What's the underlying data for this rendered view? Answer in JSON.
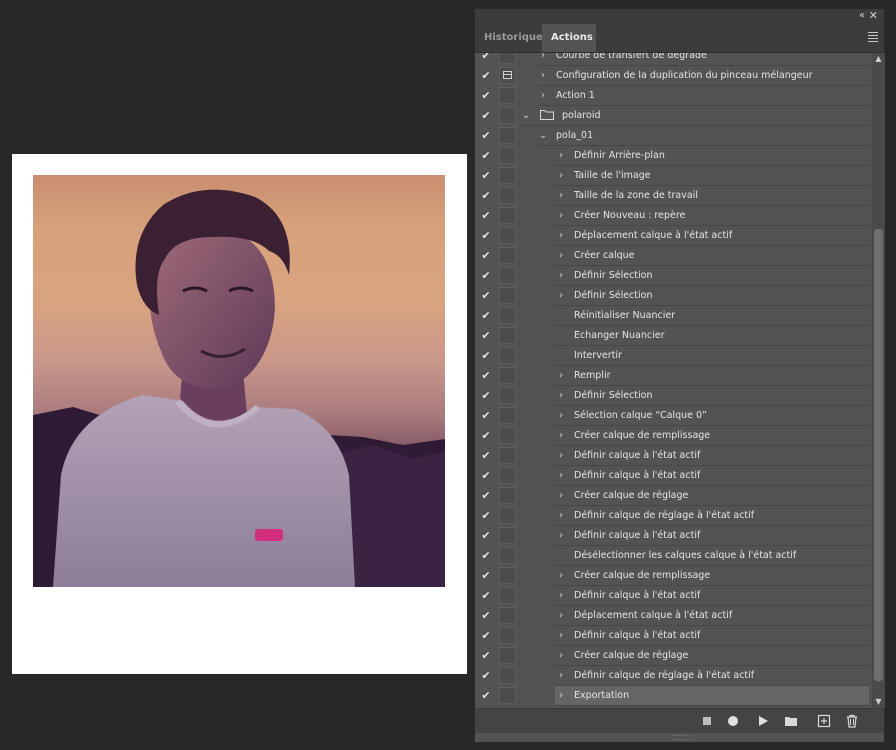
{
  "tabs": {
    "historique": "Historique",
    "actions": "Actions"
  },
  "panel_controls": {
    "collapse_glyph": "‹‹",
    "close_glyph": "✕"
  },
  "checkmark": "✔",
  "rows": [
    {
      "label": "Courbe de transfert de dégradé",
      "level": 1,
      "twisty": "›",
      "checked": true,
      "dialog": false,
      "folder": false
    },
    {
      "label": "Configuration de la duplication du pinceau mélangeur",
      "level": 1,
      "twisty": "›",
      "checked": true,
      "dialog": true,
      "folder": false
    },
    {
      "label": "Action 1",
      "level": 1,
      "twisty": "›",
      "checked": true,
      "dialog": false,
      "folder": false
    },
    {
      "label": "polaroid",
      "level": 0,
      "twisty": "⌄",
      "checked": true,
      "dialog": false,
      "folder": true
    },
    {
      "label": "pola_01",
      "level": 1,
      "twisty": "⌄",
      "checked": true,
      "dialog": false,
      "folder": false
    },
    {
      "label": "Définir Arrière-plan",
      "level": 2,
      "twisty": "›",
      "checked": true,
      "dialog": false,
      "folder": false
    },
    {
      "label": "Taille de l'image",
      "level": 2,
      "twisty": "›",
      "checked": true,
      "dialog": false,
      "folder": false
    },
    {
      "label": "Taille de la zone de travail",
      "level": 2,
      "twisty": "›",
      "checked": true,
      "dialog": false,
      "folder": false
    },
    {
      "label": "Créer Nouveau : repère",
      "level": 2,
      "twisty": "›",
      "checked": true,
      "dialog": false,
      "folder": false
    },
    {
      "label": "Déplacement calque à l'état actif",
      "level": 2,
      "twisty": "›",
      "checked": true,
      "dialog": false,
      "folder": false
    },
    {
      "label": "Créer calque",
      "level": 2,
      "twisty": "›",
      "checked": true,
      "dialog": false,
      "folder": false
    },
    {
      "label": "Définir Sélection",
      "level": 2,
      "twisty": "›",
      "checked": true,
      "dialog": false,
      "folder": false
    },
    {
      "label": "Définir Sélection",
      "level": 2,
      "twisty": "›",
      "checked": true,
      "dialog": false,
      "folder": false
    },
    {
      "label": "Réinitialiser Nuancier",
      "level": 2,
      "twisty": "",
      "checked": true,
      "dialog": false,
      "folder": false
    },
    {
      "label": "Echanger Nuancier",
      "level": 2,
      "twisty": "",
      "checked": true,
      "dialog": false,
      "folder": false
    },
    {
      "label": "Intervertir",
      "level": 2,
      "twisty": "",
      "checked": true,
      "dialog": false,
      "folder": false
    },
    {
      "label": "Remplir",
      "level": 2,
      "twisty": "›",
      "checked": true,
      "dialog": false,
      "folder": false
    },
    {
      "label": "Définir Sélection",
      "level": 2,
      "twisty": "›",
      "checked": true,
      "dialog": false,
      "folder": false
    },
    {
      "label": "Sélection calque “Calque 0”",
      "level": 2,
      "twisty": "›",
      "checked": true,
      "dialog": false,
      "folder": false
    },
    {
      "label": "Créer calque de remplissage",
      "level": 2,
      "twisty": "›",
      "checked": true,
      "dialog": false,
      "folder": false
    },
    {
      "label": "Définir calque à l'état actif",
      "level": 2,
      "twisty": "›",
      "checked": true,
      "dialog": false,
      "folder": false
    },
    {
      "label": "Définir calque à l'état actif",
      "level": 2,
      "twisty": "›",
      "checked": true,
      "dialog": false,
      "folder": false
    },
    {
      "label": "Créer calque de réglage",
      "level": 2,
      "twisty": "›",
      "checked": true,
      "dialog": false,
      "folder": false
    },
    {
      "label": "Définir calque de réglage à l'état actif",
      "level": 2,
      "twisty": "›",
      "checked": true,
      "dialog": false,
      "folder": false
    },
    {
      "label": "Définir calque à l'état actif",
      "level": 2,
      "twisty": "›",
      "checked": true,
      "dialog": false,
      "folder": false
    },
    {
      "label": "Désélectionner les calques calque à l'état actif",
      "level": 2,
      "twisty": "",
      "checked": true,
      "dialog": false,
      "folder": false
    },
    {
      "label": "Créer calque de remplissage",
      "level": 2,
      "twisty": "›",
      "checked": true,
      "dialog": false,
      "folder": false
    },
    {
      "label": "Définir calque à l'état actif",
      "level": 2,
      "twisty": "›",
      "checked": true,
      "dialog": false,
      "folder": false
    },
    {
      "label": "Déplacement calque à l'état actif",
      "level": 2,
      "twisty": "›",
      "checked": true,
      "dialog": false,
      "folder": false
    },
    {
      "label": "Définir calque à l'état actif",
      "level": 2,
      "twisty": "›",
      "checked": true,
      "dialog": false,
      "folder": false
    },
    {
      "label": "Créer calque de réglage",
      "level": 2,
      "twisty": "›",
      "checked": true,
      "dialog": false,
      "folder": false
    },
    {
      "label": "Définir calque de réglage à l'état actif",
      "level": 2,
      "twisty": "›",
      "checked": true,
      "dialog": false,
      "folder": false
    },
    {
      "label": "Exportation",
      "level": 2,
      "twisty": "›",
      "checked": true,
      "dialog": false,
      "folder": false,
      "selected": true
    }
  ],
  "toolbar": [
    "stop-icon",
    "record-icon",
    "play-icon",
    "new-set-folder-icon",
    "new-action-icon",
    "trash-icon"
  ],
  "colors": {
    "app_bg": "#282828",
    "panel_bg": "#535353",
    "selected_row": "#656565",
    "canvas": "#ffffff"
  }
}
